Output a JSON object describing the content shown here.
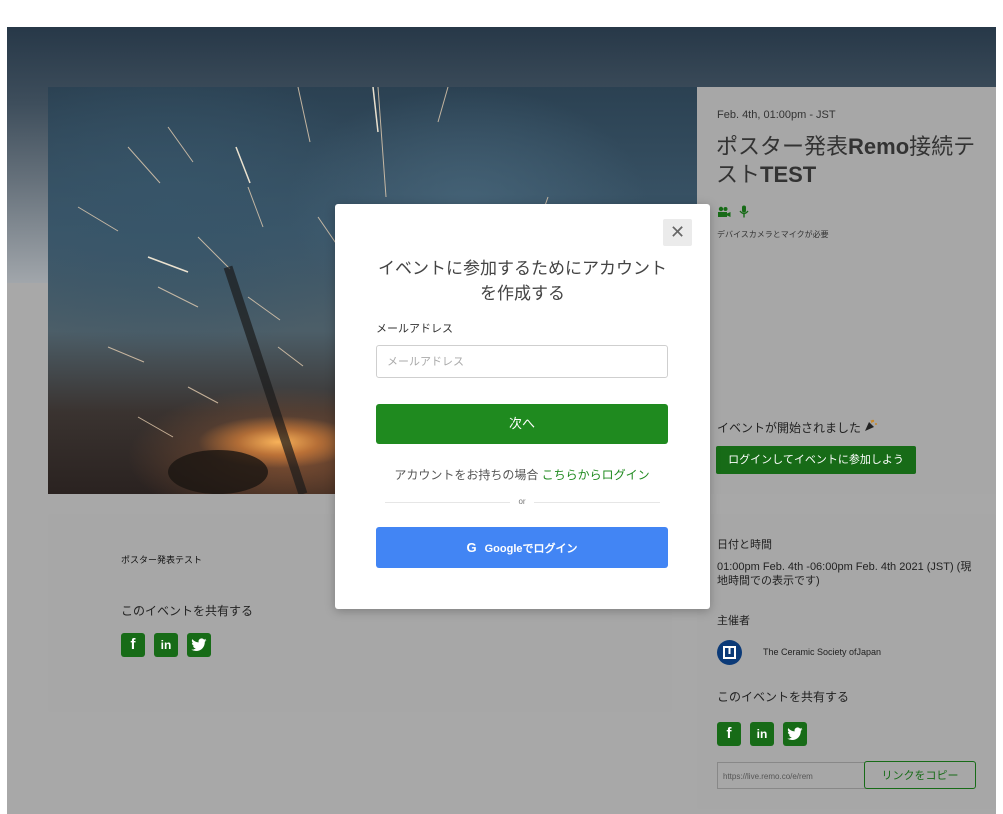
{
  "event": {
    "date": "Feb. 4th, 01:00pm - JST",
    "title_part1": "ポスター発表",
    "title_bold1": "Remo",
    "title_part2": "接続テスト",
    "title_bold2": "TEST",
    "device_note": "デバイスカメラとマイクが必要",
    "started_text": "イベントが開始されました",
    "join_button": "ログインしてイベントに参加しよう"
  },
  "info": {
    "short_title": "ポスター発表テスト",
    "share_label": "このイベントを共有する",
    "date_label": "日付と時間",
    "date_value": "01:00pm Feb. 4th -06:00pm Feb. 4th 2021 (JST) (現地時間での表示です)",
    "host_label": "主催者",
    "host_name": "The Ceramic Society ofJapan",
    "share_label_right": "このイベントを共有する",
    "link_value": "https://live.remo.co/e/rem",
    "copy_button": "リンクをコピー"
  },
  "social": {
    "facebook": "f",
    "linkedin": "in",
    "twitter_icon": "twitter-icon"
  },
  "modal": {
    "close": "✕",
    "title": "イベントに参加するためにアカウントを作成する",
    "email_label": "メールアドレス",
    "email_placeholder": "メールアドレス",
    "email_value": "",
    "next_button": "次へ",
    "have_account": "アカウントをお持ちの場合",
    "login_link": "こちらからログイン",
    "or_text": "or",
    "google_icon": "G",
    "google_button": "Googleでログイン"
  },
  "colors": {
    "brand_green": "#1f8a1f",
    "dark_green": "#176b17",
    "google_blue": "#4285f4"
  }
}
